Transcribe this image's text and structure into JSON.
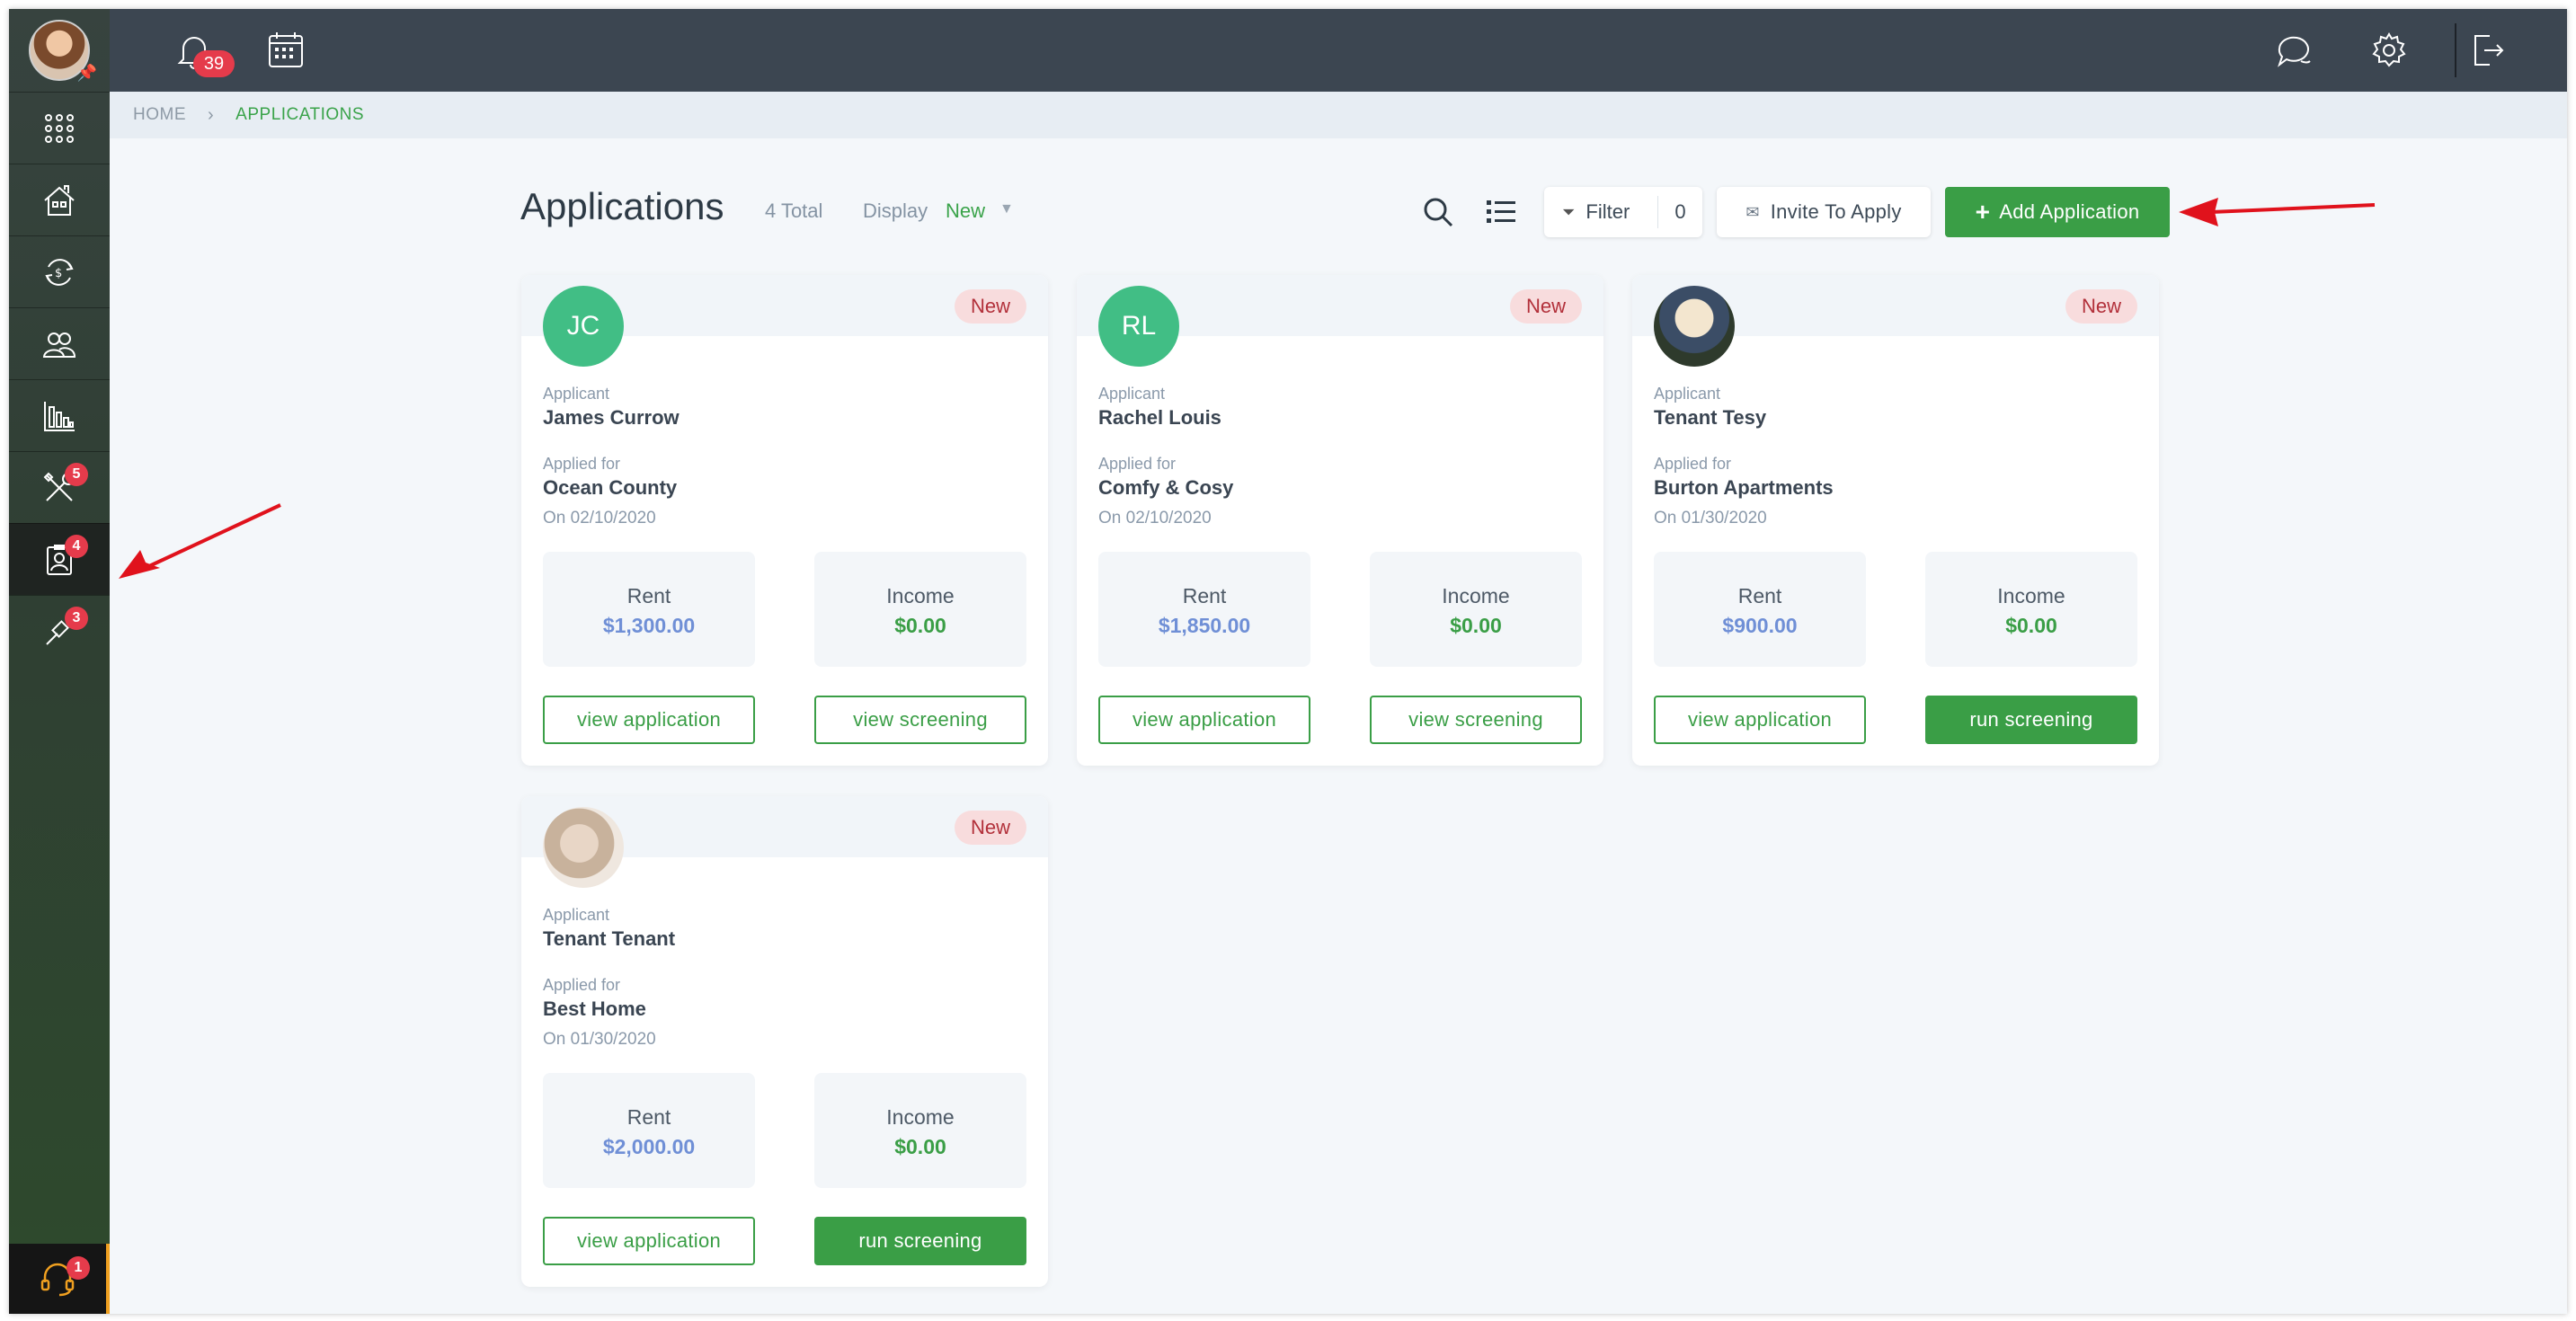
{
  "topbar": {
    "notifications_count": "39"
  },
  "sidebar": {
    "items": [
      {
        "icon": "grid-icon",
        "badge": ""
      },
      {
        "icon": "properties-icon",
        "badge": ""
      },
      {
        "icon": "accounting-icon",
        "badge": ""
      },
      {
        "icon": "people-icon",
        "badge": ""
      },
      {
        "icon": "reports-icon",
        "badge": ""
      },
      {
        "icon": "maintenance-icon",
        "badge": "5"
      },
      {
        "icon": "applications-icon",
        "badge": "4"
      },
      {
        "icon": "tools-icon",
        "badge": "3"
      }
    ],
    "support_badge": "1"
  },
  "breadcrumb": {
    "home": "HOME",
    "current": "APPLICATIONS"
  },
  "header": {
    "title": "Applications",
    "total": "4 Total",
    "display_label": "Display",
    "display_value": "New",
    "filter_label": "Filter",
    "filter_count": "0",
    "invite_label": "Invite To Apply",
    "add_label": "Add Application"
  },
  "cards": [
    {
      "initials": "JC",
      "status": "New",
      "applicant_label": "Applicant",
      "applicant": "James Currow",
      "applied_for_label": "Applied for",
      "property": "Ocean County",
      "date": "On 02/10/2020",
      "rent_label": "Rent",
      "rent": "$1,300.00",
      "income_label": "Income",
      "income": "$0.00",
      "btn1": "view application",
      "btn2": "view screening"
    },
    {
      "initials": "RL",
      "status": "New",
      "applicant_label": "Applicant",
      "applicant": "Rachel Louis",
      "applied_for_label": "Applied for",
      "property": "Comfy & Cosy",
      "date": "On 02/10/2020",
      "rent_label": "Rent",
      "rent": "$1,850.00",
      "income_label": "Income",
      "income": "$0.00",
      "btn1": "view application",
      "btn2": "view screening"
    },
    {
      "initials": "",
      "status": "New",
      "applicant_label": "Applicant",
      "applicant": "Tenant Tesy",
      "applied_for_label": "Applied for",
      "property": "Burton Apartments",
      "date": "On 01/30/2020",
      "rent_label": "Rent",
      "rent": "$900.00",
      "income_label": "Income",
      "income": "$0.00",
      "btn1": "view application",
      "btn2": "run screening"
    },
    {
      "initials": "",
      "status": "New",
      "applicant_label": "Applicant",
      "applicant": "Tenant Tenant",
      "applied_for_label": "Applied for",
      "property": "Best Home",
      "date": "On 01/30/2020",
      "rent_label": "Rent",
      "rent": "$2,000.00",
      "income_label": "Income",
      "income": "$0.00",
      "btn1": "view application",
      "btn2": "run screening"
    }
  ],
  "colors": {
    "accent": "#3a9e46",
    "topbar": "#3c4651",
    "badge": "#e53b4b",
    "annotation_arrow": "#e0121c"
  }
}
